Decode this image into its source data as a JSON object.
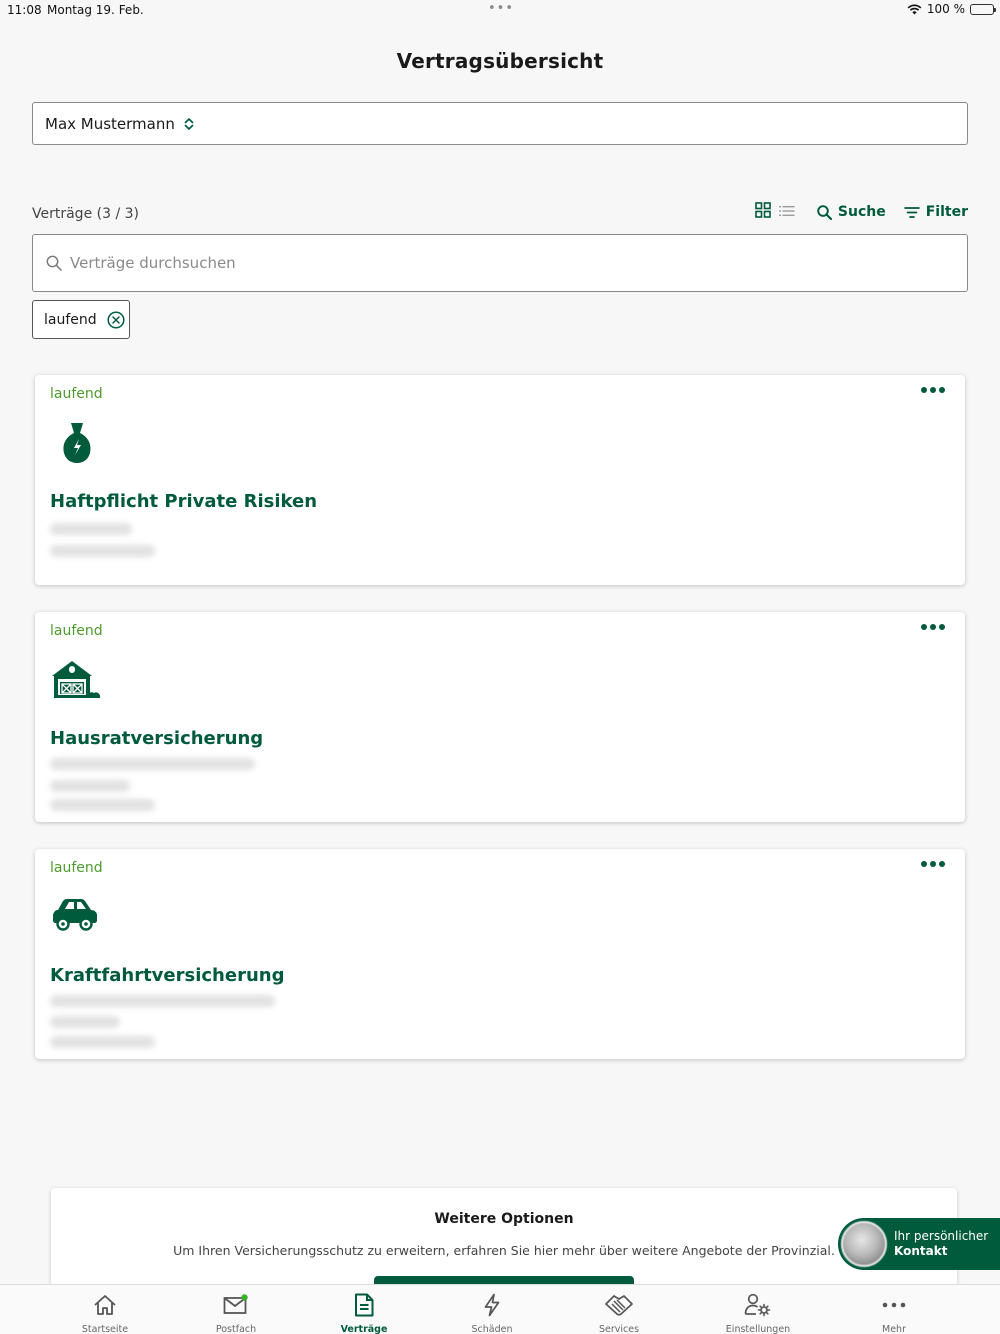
{
  "status_bar": {
    "time": "11:08",
    "date": "Montag 19. Feb.",
    "battery": "100 %"
  },
  "page": {
    "title": "Vertragsübersicht"
  },
  "person_select": {
    "value": "Max Mustermann"
  },
  "contracts_header": {
    "count_label": "Verträge (3 / 3)",
    "search_label": "Suche",
    "filter_label": "Filter"
  },
  "search": {
    "placeholder": "Verträge durchsuchen"
  },
  "filter_chip": {
    "label": "laufend"
  },
  "contracts": [
    {
      "status": "laufend",
      "title": "Haftpflicht Private Risiken",
      "icon": "vase-icon"
    },
    {
      "status": "laufend",
      "title": "Hausratversicherung",
      "icon": "house-icon"
    },
    {
      "status": "laufend",
      "title": "Kraftfahrtversicherung",
      "icon": "car-icon"
    }
  ],
  "options": {
    "title": "Weitere Optionen",
    "text": "Um Ihren Versicherungsschutz zu erweitern, erfahren Sie hier mehr über weitere Angebote der Provinzial."
  },
  "contact": {
    "line1": "Ihr persönlicher",
    "line2": "Kontakt"
  },
  "tabs": [
    {
      "label": "Startseite",
      "icon": "home-icon"
    },
    {
      "label": "Postfach",
      "icon": "mail-icon"
    },
    {
      "label": "Verträge",
      "icon": "document-icon"
    },
    {
      "label": "Schäden",
      "icon": "lightning-icon"
    },
    {
      "label": "Services",
      "icon": "handshake-icon"
    },
    {
      "label": "Einstellungen",
      "icon": "user-settings-icon"
    },
    {
      "label": "Mehr",
      "icon": "more-icon"
    }
  ],
  "colors": {
    "brand": "#005a3c",
    "status_green": "#4d9a2e",
    "notification_dot": "#3dae2b"
  }
}
